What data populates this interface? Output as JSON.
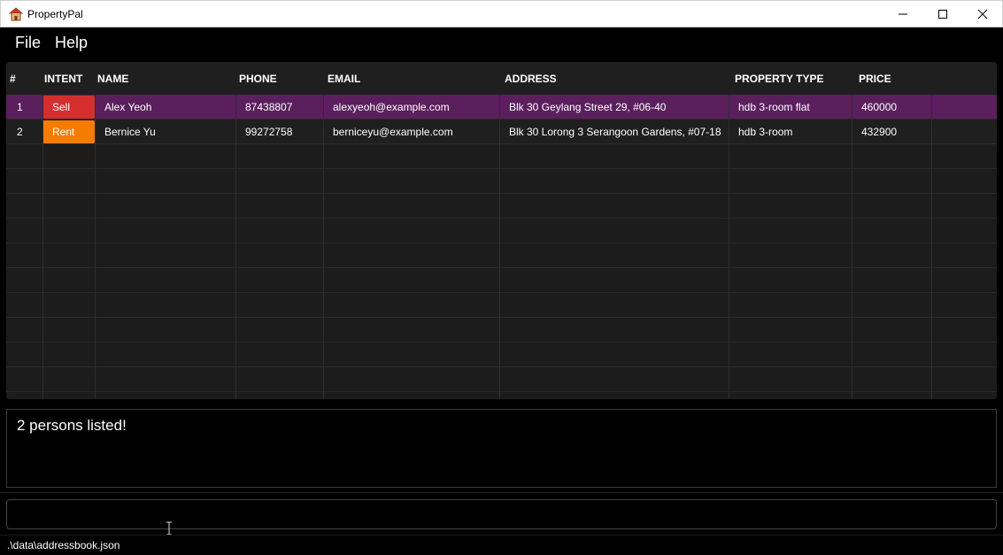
{
  "window": {
    "title": "PropertyPal"
  },
  "menu": {
    "file": "File",
    "help": "Help"
  },
  "table": {
    "headers": {
      "index": "#",
      "intent": "INTENT",
      "name": "NAME",
      "phone": "PHONE",
      "email": "EMAIL",
      "address": "ADDRESS",
      "property_type": "PROPERTY TYPE",
      "price": "PRICE"
    },
    "rows": [
      {
        "index": "1",
        "intent": "Sell",
        "intent_color": "#d32f2f",
        "name": "Alex Yeoh",
        "phone": "87438807",
        "email": "alexyeoh@example.com",
        "address": "Blk 30 Geylang Street 29, #06-40",
        "property_type": "hdb 3-room flat",
        "price": "460000"
      },
      {
        "index": "2",
        "intent": "Rent",
        "intent_color": "#f57c00",
        "name": "Bernice Yu",
        "phone": "99272758",
        "email": "berniceyu@example.com",
        "address": "Blk 30 Lorong 3 Serangoon Gardens, #07-18",
        "property_type": "hdb 3-room",
        "price": "432900"
      }
    ],
    "selected_row": 0
  },
  "result": {
    "message": "2 persons listed!"
  },
  "command": {
    "value": ""
  },
  "status": {
    "file_path": ".\\data\\addressbook.json"
  },
  "colors": {
    "selected_row": "#5b1f5d",
    "panel": "#1f1f1f",
    "background": "#000000"
  }
}
